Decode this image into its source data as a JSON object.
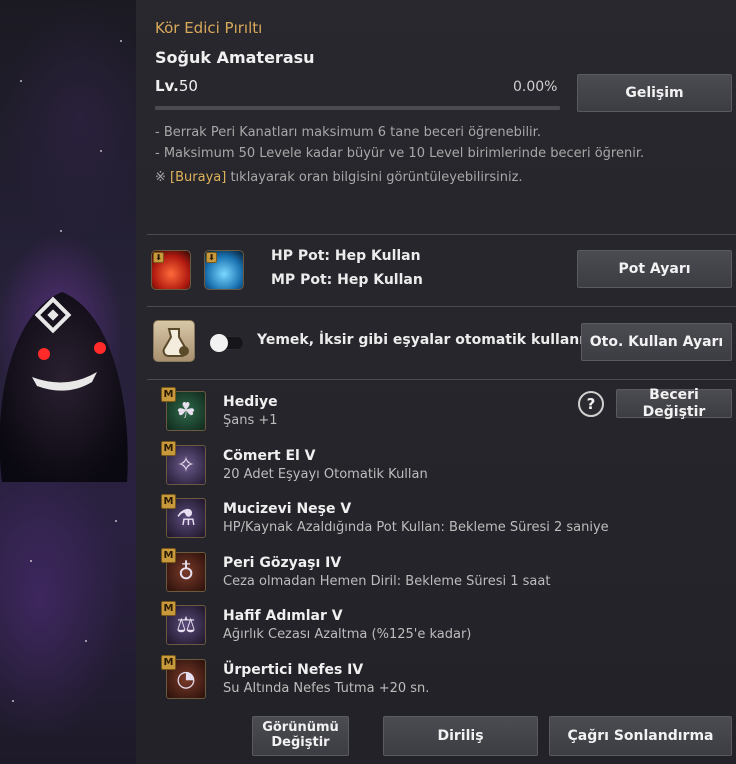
{
  "pet": {
    "title": "Kör Edici Pırıltı",
    "name": "Soğuk Amaterasu",
    "level_prefix": "Lv.",
    "level": "50",
    "exp_percent_text": "0.00%",
    "exp_fraction": 0.0
  },
  "buttons": {
    "growth": "Gelişim",
    "pot_settings": "Pot Ayarı",
    "auto_use_settings": "Oto. Kullan Ayarı",
    "change_skill": "Beceri Değiştir",
    "change_appearance": "Görünümü Değiştir",
    "revive": "Diriliş",
    "end_summon": "Çağrı Sonlandırma"
  },
  "info": {
    "line1": "- Berrak Peri Kanatları maksimum 6 tane beceri öğrenebilir.",
    "line2": "- Maksimum 50 Levele kadar büyür ve 10 Level birimlerinde beceri öğrenir.",
    "note_mark": "※",
    "note_link": "[Buraya]",
    "note_rest": " tıklayarak oran bilgisini görüntüleyebilirsiniz."
  },
  "pots": {
    "hp": "HP Pot: Hep Kullan",
    "mp": "MP Pot: Hep Kullan"
  },
  "auto_use": {
    "label": "Yemek, İksir gibi eşyalar otomatik kullanılır.",
    "enabled": false
  },
  "skill_badge": "M",
  "help_icon_text": "?",
  "skills": [
    {
      "name": "Hediye",
      "desc": "Şans +1",
      "icon": "clover-icon"
    },
    {
      "name": "Cömert El V",
      "desc": "20 Adet Eşyayı Otomatik Kullan",
      "icon": "fairy-icon"
    },
    {
      "name": "Mucizevi Neşe V",
      "desc": "HP/Kaynak Azaldığında Pot Kullan: Bekleme Süresi 2 saniye",
      "icon": "potion-plus-icon"
    },
    {
      "name": "Peri Gözyaşı IV",
      "desc": "Ceza olmadan Hemen Diril: Bekleme Süresi 1 saat",
      "icon": "tear-flask-icon"
    },
    {
      "name": "Hafif Adımlar V",
      "desc": "Ağırlık Cezası Azaltma (%125'e kadar)",
      "icon": "weight-icon"
    },
    {
      "name": "Ürpertici Nefes IV",
      "desc": "Su Altında Nefes Tutma +20 sn.",
      "icon": "breath-timer-icon"
    }
  ]
}
